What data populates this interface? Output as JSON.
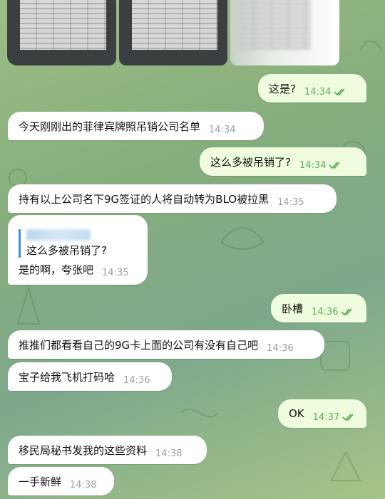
{
  "photos": [
    {
      "name": "document-photo-1"
    },
    {
      "name": "document-photo-2"
    },
    {
      "name": "document-photo-3"
    }
  ],
  "messages": [
    {
      "id": "m1",
      "direction": "out",
      "text": "这是?",
      "time": "14:34",
      "read": true
    },
    {
      "id": "m2",
      "direction": "in",
      "text": "今天刚刚出的菲律宾牌照吊销公司名单",
      "time": "14:34"
    },
    {
      "id": "m3",
      "direction": "out",
      "text": "这么多被吊销了?",
      "time": "14:34",
      "read": true
    },
    {
      "id": "m4",
      "direction": "in",
      "text": "持有以上公司名下9G签证的人将自动转为BLO被拉黑",
      "time": "14:35"
    },
    {
      "id": "m5",
      "direction": "in",
      "reply_to": "这么多被吊销了?",
      "text": "是的啊，夸张吧",
      "time": "14:35"
    },
    {
      "id": "m6",
      "direction": "out",
      "text": "卧槽",
      "time": "14:36",
      "read": true
    },
    {
      "id": "m7",
      "direction": "in",
      "text": "推推们都看看自己的9G卡上面的公司有没有自己吧",
      "time": "14:36"
    },
    {
      "id": "m8",
      "direction": "in",
      "text": "宝子给我飞机打码哈",
      "time": "14:36"
    },
    {
      "id": "m9",
      "direction": "out",
      "text": "OK",
      "time": "14:37",
      "read": true
    },
    {
      "id": "m10",
      "direction": "in",
      "text": "移民局秘书发我的这些资料",
      "time": "14:38"
    },
    {
      "id": "m11",
      "direction": "in",
      "text": "一手新鲜",
      "time": "14:38"
    }
  ],
  "colors": {
    "incoming_bubble": "#ffffff",
    "outgoing_bubble": "#effdde",
    "outgoing_time": "#5fae57",
    "reply_bar": "#3a8ee6"
  },
  "icons": {
    "read_receipt": "double-check-icon"
  }
}
